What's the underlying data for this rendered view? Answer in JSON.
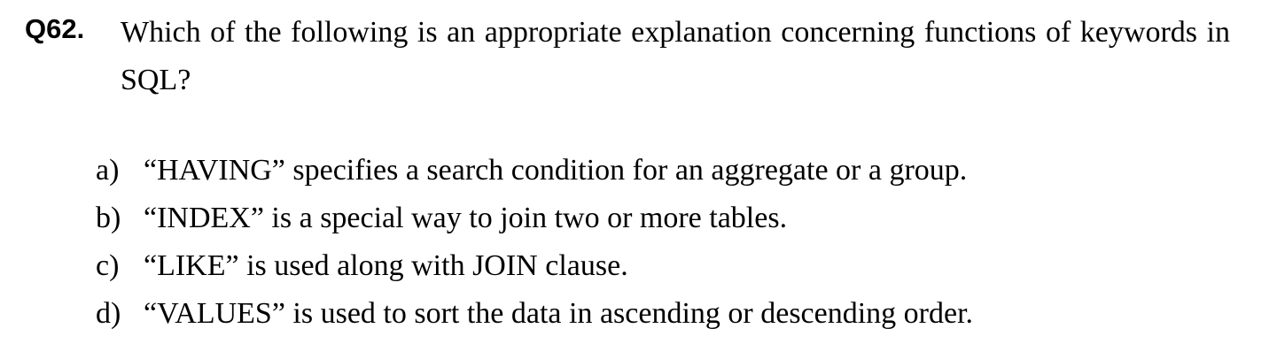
{
  "question": {
    "number": "Q62.",
    "text": "Which of the following is an appropriate explanation concerning functions of keywords in SQL?"
  },
  "options": [
    {
      "label": "a)",
      "text": "“HAVING” specifies a search condition for an aggregate or a group."
    },
    {
      "label": "b)",
      "text": "“INDEX” is a special way to join two or more tables."
    },
    {
      "label": "c)",
      "text": "“LIKE” is used along with JOIN clause."
    },
    {
      "label": "d)",
      "text": "“VALUES” is used to sort the data in ascending or descending order."
    }
  ]
}
